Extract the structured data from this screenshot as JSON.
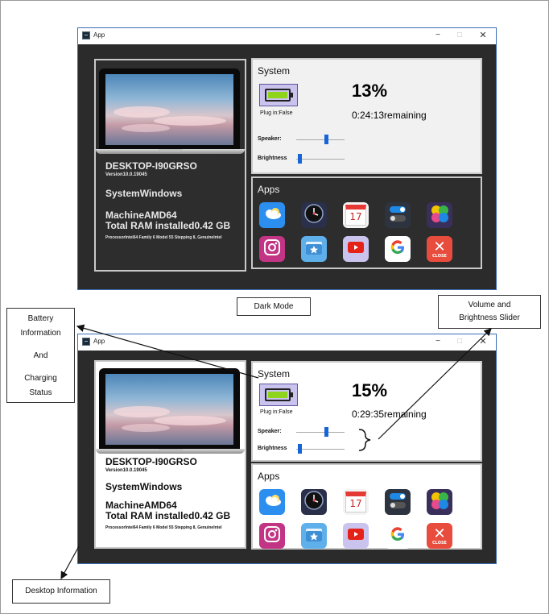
{
  "callouts": {
    "dark_mode": "Dark Mode",
    "battery_l1": "Battery",
    "battery_l2": "Information",
    "battery_l3": "And",
    "battery_l4": "Charging",
    "battery_l5": "Status",
    "volume_l1": "Volume and",
    "volume_l2": "Brightness Slider",
    "desktop": "Desktop Information"
  },
  "windows": [
    {
      "mode": "dark",
      "title": "App",
      "controls": {
        "minimize": "−",
        "maximize": "□",
        "close": "✕"
      },
      "device": {
        "hostname": "DESKTOP-I90GRSO",
        "version": "Version10.0.19045",
        "system": "SystemWindows",
        "machine": "MachineAMD64",
        "ram": "Total RAM installed0.42 GB",
        "processor": "ProcessorIntel64 Family 6 Model 55 Stepping 8, GenuineIntel"
      },
      "system": {
        "title": "System",
        "plugged": "Plug in:False",
        "battery_percent": "13%",
        "battery_level": 0.13,
        "remaining": "0:24:13remaining",
        "speaker_label": "Speaker:",
        "speaker_level": 0.62,
        "brightness_label": "Brightness",
        "brightness_level": 0.04
      },
      "apps_title": "Apps"
    },
    {
      "mode": "light",
      "title": "App",
      "controls": {
        "minimize": "−",
        "maximize": "□",
        "close": "✕"
      },
      "device": {
        "hostname": "DESKTOP-I90GRSO",
        "version": "Version10.0.19045",
        "system": "SystemWindows",
        "machine": "MachineAMD64",
        "ram": "Total RAM installed0.42 GB",
        "processor": "ProcessorIntel64 Family 6 Model 55 Stepping 8, GenuineIntel"
      },
      "system": {
        "title": "System",
        "plugged": "Plug in:False",
        "battery_percent": "15%",
        "battery_level": 0.15,
        "remaining": "0:29:35remaining",
        "speaker_label": "Speaker:",
        "speaker_level": 0.62,
        "brightness_label": "Brightness",
        "brightness_level": 0.04
      },
      "apps_title": "Apps"
    }
  ],
  "apps": [
    {
      "name": "weather",
      "icon": "weather-icon",
      "bg": "#2c8ff0"
    },
    {
      "name": "clock",
      "icon": "clock-icon",
      "bg": "#2a2f4a"
    },
    {
      "name": "calendar",
      "icon": "calendar-icon",
      "bg": "#f4f4f4",
      "text": "17"
    },
    {
      "name": "settings toggle",
      "icon": "toggle-icon",
      "bg": "#2d3440"
    },
    {
      "name": "game",
      "icon": "game-icon",
      "bg": "#3a2f5a"
    },
    {
      "name": "instagram",
      "icon": "instagram-icon",
      "bg": "#c13584"
    },
    {
      "name": "files",
      "icon": "folder-icon",
      "bg": "#5fb0ea"
    },
    {
      "name": "youtube",
      "icon": "youtube-icon",
      "bg": "#c9c3ee"
    },
    {
      "name": "google",
      "icon": "google-icon",
      "bg": "#ffffff"
    },
    {
      "name": "close",
      "icon": "close-app-icon",
      "bg": "#e84c3d",
      "text": "CLOSE"
    }
  ]
}
